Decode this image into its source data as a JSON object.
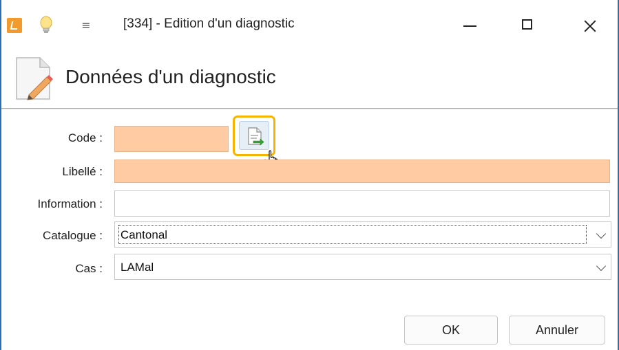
{
  "window": {
    "title": "[334] -  Edition d'un diagnostic"
  },
  "header": {
    "title": "Données d'un diagnostic"
  },
  "form": {
    "code": {
      "label": "Code :",
      "value": ""
    },
    "libelle": {
      "label": "Libellé :",
      "value": ""
    },
    "information": {
      "label": "Information :",
      "value": ""
    },
    "catalogue": {
      "label": "Catalogue :",
      "value": "Cantonal"
    },
    "cas": {
      "label": "Cas :",
      "value": "LAMal"
    }
  },
  "buttons": {
    "ok": "OK",
    "cancel": "Annuler"
  },
  "icons": {
    "app": "app-icon",
    "tip": "lightbulb-icon",
    "quick_access": "quick-access-icon",
    "header": "document-edit-icon",
    "lookup": "document-arrow-icon"
  },
  "colors": {
    "required_field": "#ffcba2",
    "highlight": "#f4b400",
    "window_border": "#2a6fb6"
  }
}
